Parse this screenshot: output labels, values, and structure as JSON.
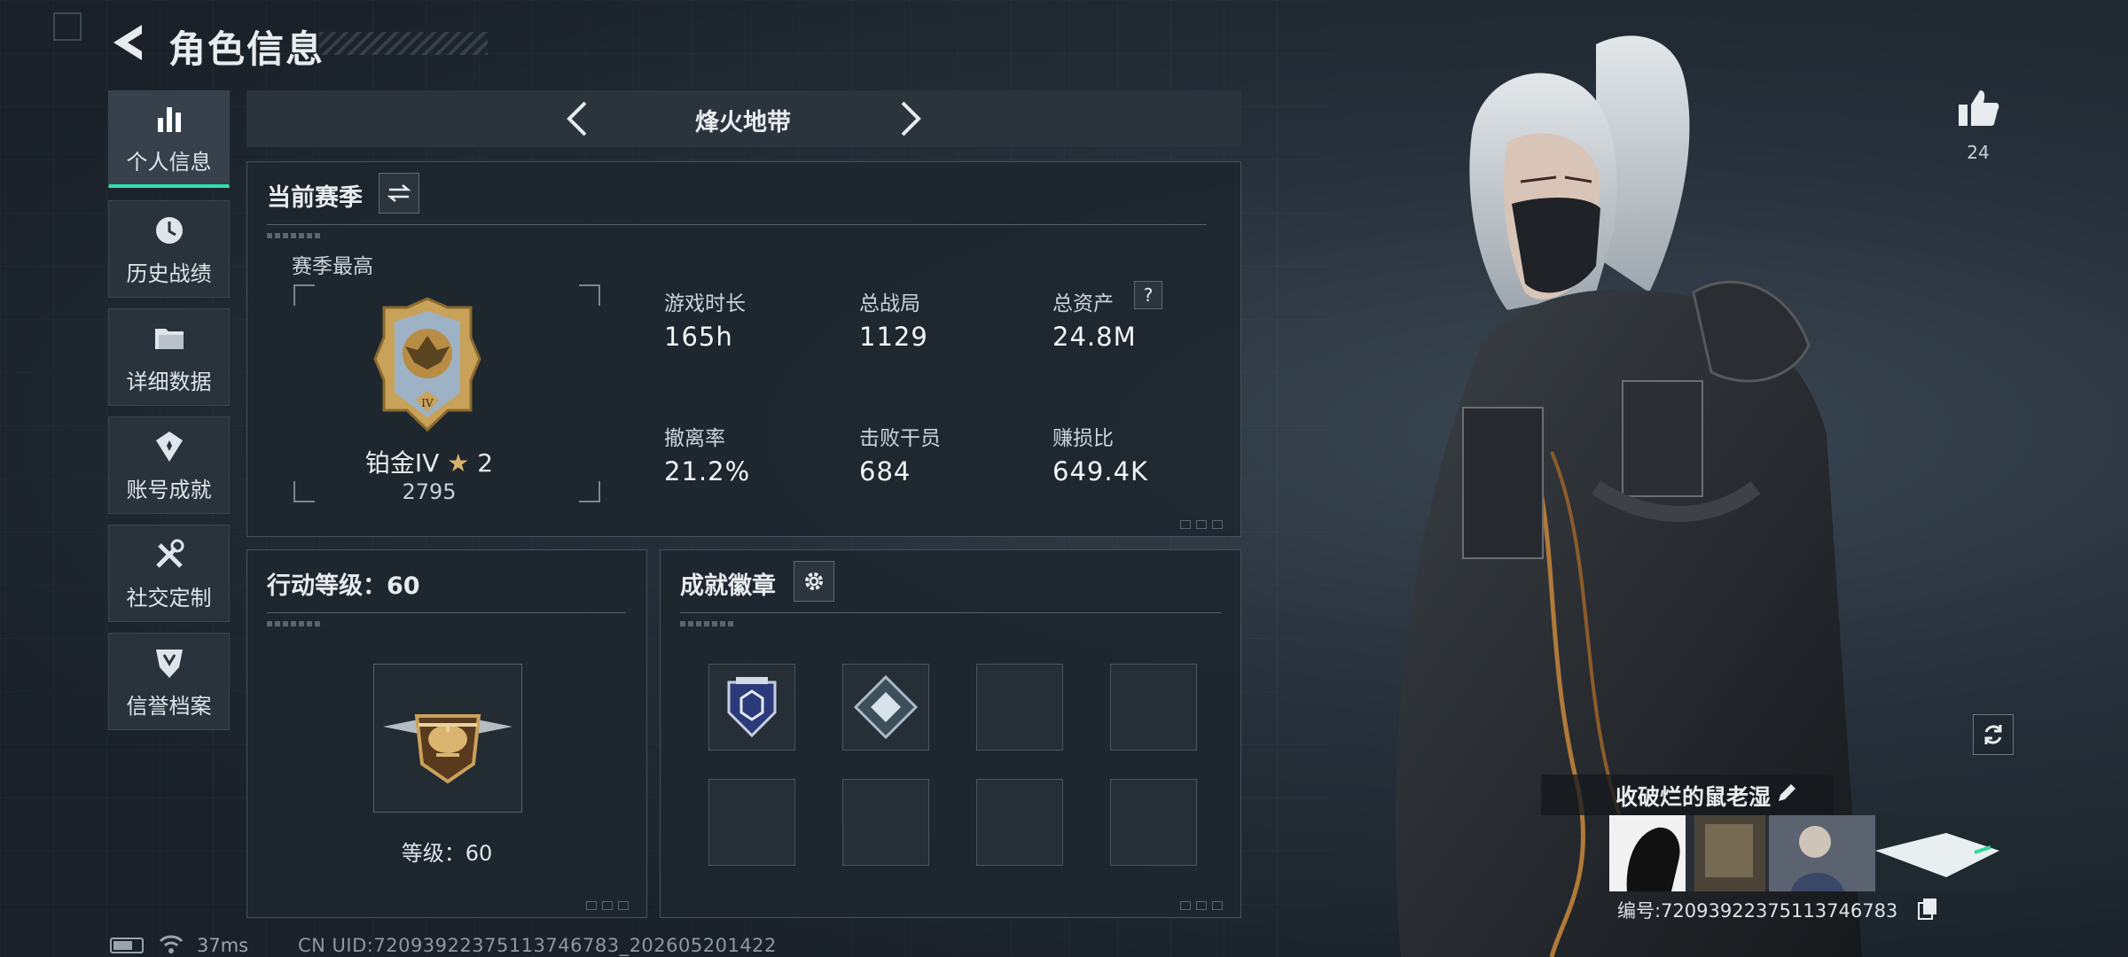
{
  "header": {
    "title": "角色信息"
  },
  "sidebar": {
    "items": [
      {
        "label": "个人信息",
        "icon": "bar-chart-icon",
        "active": true
      },
      {
        "label": "历史战绩",
        "icon": "history-clock-icon",
        "active": false
      },
      {
        "label": "详细数据",
        "icon": "folder-icon",
        "active": false
      },
      {
        "label": "账号成就",
        "icon": "achievement-icon",
        "active": false
      },
      {
        "label": "社交定制",
        "icon": "tools-icon",
        "active": false
      },
      {
        "label": "信誉档案",
        "icon": "shield-credit-icon",
        "active": false
      }
    ]
  },
  "mode": {
    "title": "烽火地带"
  },
  "season": {
    "title": "当前赛季",
    "best_label": "赛季最高",
    "rank_name": "铂金IV",
    "rank_stars": "2",
    "rank_score": "2795",
    "stats": [
      {
        "label": "游戏时长",
        "value": "165h"
      },
      {
        "label": "总战局",
        "value": "1129"
      },
      {
        "label": "总资产",
        "value": "24.8M",
        "help": "?"
      },
      {
        "label": "撤离率",
        "value": "21.2%"
      },
      {
        "label": "击败干员",
        "value": "684"
      },
      {
        "label": "赚损比",
        "value": "649.4K"
      }
    ]
  },
  "action_level": {
    "title": "行动等级：60",
    "level_text": "等级：60"
  },
  "badges": {
    "title": "成就徽章",
    "slot_count": 8,
    "filled": 2
  },
  "profile": {
    "likes": "24",
    "name": "收破烂的鼠老湿",
    "id_text": "编号:7209392237511374​6783"
  },
  "status": {
    "battery_level": 0.7,
    "ping": "37ms",
    "uid": "CN UID:7209392237511374​6783_202605201422"
  },
  "colors": {
    "accent": "#2fe0b0",
    "panel_border": "#46525c",
    "gold": "#c9a25a"
  }
}
